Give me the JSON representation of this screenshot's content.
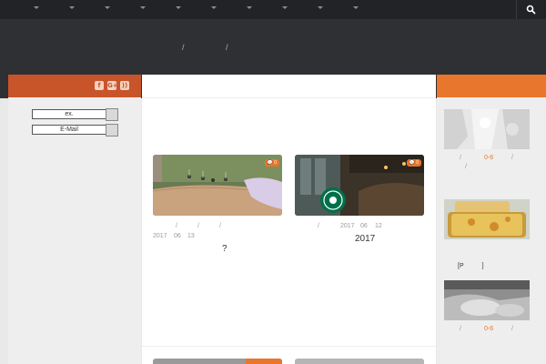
{
  "nav": {
    "items": [
      {
        "label": ""
      },
      {
        "label": ""
      },
      {
        "label": ""
      },
      {
        "label": ""
      },
      {
        "label": ""
      },
      {
        "label": ""
      },
      {
        "label": ""
      },
      {
        "label": ""
      },
      {
        "label": ""
      },
      {
        "label": ""
      }
    ]
  },
  "breadcrumb": {
    "separator": "/"
  },
  "sidebar_left": {
    "search_placeholder": "ex.",
    "email_placeholder": "E-Mail",
    "social": [
      {
        "icon": "facebook-icon",
        "glyph": "f"
      },
      {
        "icon": "googleplus-icon",
        "glyph": "G+"
      },
      {
        "icon": "rss-icon",
        "glyph": "))"
      }
    ]
  },
  "posts": [
    {
      "comments": "0",
      "meta_sep": "/",
      "year": "2017",
      "month": "06",
      "day": "13",
      "title": "?"
    },
    {
      "comments": "0",
      "meta_sep": "/",
      "year": "2017",
      "month": "06",
      "day": "12",
      "title": "2017"
    }
  ],
  "sidebar_right": {
    "items": [
      {
        "meta_sep": "/",
        "highlight": "0-6"
      },
      {
        "label": "[P",
        "label_end": "]"
      },
      {
        "meta_sep": "/",
        "highlight": "0-6"
      }
    ]
  },
  "colors": {
    "left_header": "#c8542a",
    "right_header": "#e8762c",
    "topbar": "#222326",
    "hero": "#2f3033"
  }
}
